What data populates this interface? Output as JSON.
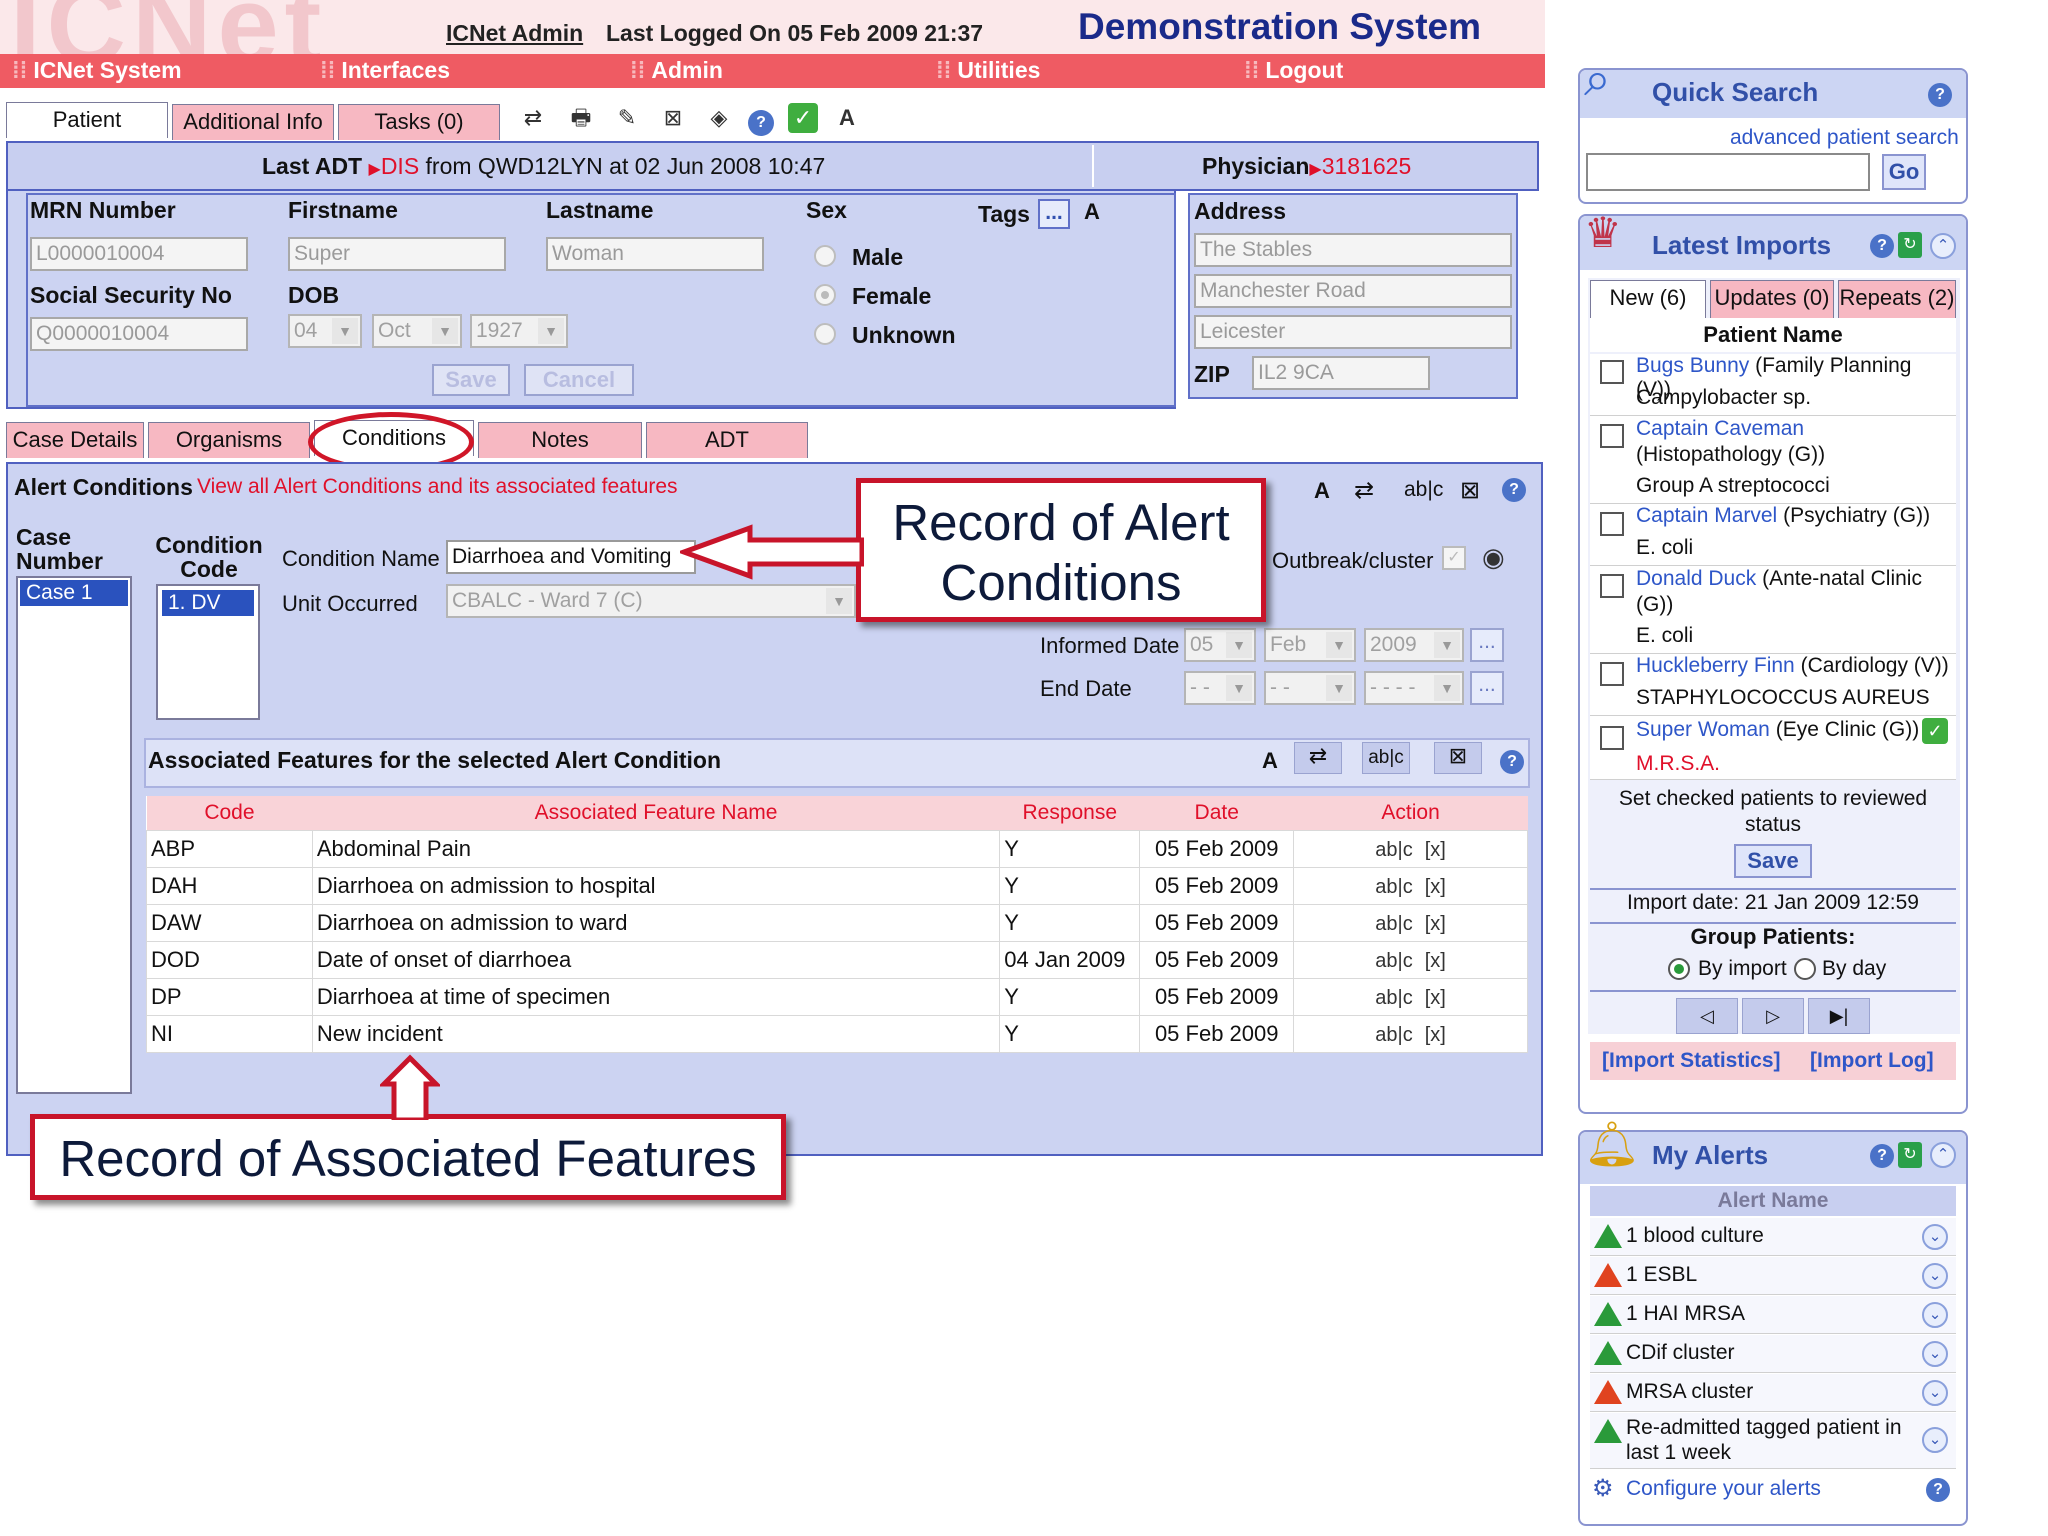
{
  "header": {
    "bg_logo": "ICNet",
    "admin_user": "ICNet Admin",
    "last_logged": "Last Logged On  05 Feb 2009 21:37",
    "system_title": "Demonstration System"
  },
  "menu": [
    "ICNet System",
    "Interfaces",
    "Admin",
    "Utilities",
    "Logout"
  ],
  "patient_tabs": [
    "Patient",
    "Additional Info",
    "Tasks (0)"
  ],
  "adt": {
    "label": "Last ADT",
    "code": "DIS",
    "text": "from QWD12LYN at 02 Jun 2008 10:47",
    "physician_label": "Physician",
    "physician_value": "3181625"
  },
  "patient": {
    "mrn_label": "MRN Number",
    "mrn_value": "L0000010004",
    "firstname_label": "Firstname",
    "firstname_value": "Super",
    "lastname_label": "Lastname",
    "lastname_value": "Woman",
    "sex_label": "Sex",
    "sex_options": [
      "Male",
      "Female",
      "Unknown"
    ],
    "sex_selected": "Female",
    "tags_label": "Tags",
    "tags_button": "...",
    "ssn_label": "Social Security No",
    "ssn_value": "Q0000010004",
    "dob_label": "DOB",
    "dob_day": "04",
    "dob_month": "Oct",
    "dob_year": "1927",
    "save": "Save",
    "cancel": "Cancel"
  },
  "address": {
    "label": "Address",
    "line1": "The Stables",
    "line2": "Manchester Road",
    "line3": "Leicester",
    "zip_label": "ZIP",
    "zip_value": "IL2 9CA"
  },
  "case_tabs": [
    "Case Details",
    "Organisms",
    "Conditions",
    "Notes",
    "ADT"
  ],
  "alert_conditions": {
    "title": "Alert Conditions",
    "link": "View all Alert Conditions and its associated features",
    "case_number_label": "Case Number",
    "case_item": "Case 1",
    "condition_code_label": "Condition Code",
    "condition_code_item": "1. DV",
    "condition_name_label": "Condition Name",
    "condition_name_value": "Diarrhoea and Vomiting",
    "unit_label": "Unit Occurred",
    "unit_value": "CBALC - Ward 7 (C)",
    "outbreak_label": "Outbreak/cluster",
    "informed_label": "Informed Date",
    "informed_day": "05",
    "informed_month": "Feb",
    "informed_year": "2009",
    "end_label": "End Date",
    "end_day": "- -",
    "end_month": "- -",
    "end_year": "- - - -",
    "ellipsis": "..."
  },
  "features": {
    "title": "Associated Features for the selected Alert Condition",
    "columns": [
      "Code",
      "Associated Feature Name",
      "Response",
      "Date",
      "Action"
    ],
    "rows": [
      [
        "ABP",
        "Abdominal Pain",
        "Y",
        "05 Feb 2009"
      ],
      [
        "DAH",
        "Diarrhoea on admission to hospital",
        "Y",
        "05 Feb 2009"
      ],
      [
        "DAW",
        "Diarrhoea on admission to ward",
        "Y",
        "05 Feb 2009"
      ],
      [
        "DOD",
        "Date of onset of diarrhoea",
        "04 Jan 2009",
        "05 Feb 2009"
      ],
      [
        "DP",
        "Diarrhoea at time of specimen",
        "Y",
        "05 Feb 2009"
      ],
      [
        "NI",
        "New incident",
        "Y",
        "05 Feb 2009"
      ]
    ],
    "action_edit": "ab|c",
    "action_delete": "[x]"
  },
  "callouts": {
    "alert_conditions": "Record of Alert Conditions",
    "associated_features": "Record of Associated Features"
  },
  "quick_search": {
    "title": "Quick Search",
    "advanced_link": "advanced patient search",
    "input_value": "",
    "go": "Go"
  },
  "latest_imports": {
    "title": "Latest Imports",
    "tabs": [
      "New (6)",
      "Updates (0)",
      "Repeats (2)"
    ],
    "column": "Patient Name",
    "patients": [
      {
        "name": "Bugs Bunny",
        "clinic": "(Family Planning (V))",
        "organism": "Campylobacter sp.",
        "organism_red": false
      },
      {
        "name": "Captain Caveman",
        "clinic": "(Histopathology (G))",
        "organism": "Group A streptococci",
        "organism_red": false
      },
      {
        "name": "Captain Marvel",
        "clinic": "(Psychiatry (G))",
        "organism": "E. coli",
        "organism_red": false
      },
      {
        "name": "Donald Duck",
        "clinic": "(Ante-natal Clinic (G))",
        "organism": "E. coli",
        "organism_red": false
      },
      {
        "name": "Huckleberry Finn",
        "clinic": "(Cardiology (V))",
        "organism": "STAPHYLOCOCCUS AUREUS",
        "organism_red": false
      },
      {
        "name": "Super Woman",
        "clinic": "(Eye Clinic (G))",
        "organism": "M.R.S.A.",
        "organism_red": true
      }
    ],
    "set_checked": "Set checked patients to reviewed status",
    "save": "Save",
    "import_date": "Import date: 21 Jan 2009 12:59",
    "group_label": "Group Patients:",
    "group_options": [
      "By import",
      "By day"
    ],
    "group_selected": "By import",
    "stats_link": "[Import Statistics]",
    "log_link": "[Import Log]"
  },
  "my_alerts": {
    "title": "My Alerts",
    "column": "Alert Name",
    "alerts": [
      {
        "name": "1 blood culture",
        "color": "#2a9a3a"
      },
      {
        "name": "1 ESBL",
        "color": "#e0431f"
      },
      {
        "name": "1 HAI MRSA",
        "color": "#2a9a3a"
      },
      {
        "name": "CDif cluster",
        "color": "#2a9a3a"
      },
      {
        "name": "MRSA cluster",
        "color": "#e0431f"
      },
      {
        "name": "Re-admitted tagged patient in last 1 week",
        "color": "#2a9a3a"
      }
    ],
    "configure": "Configure your alerts"
  },
  "colors": {
    "menu_bar": "#ef5b63",
    "panel": "#ccd3f2",
    "accent_red": "#e0102a",
    "link_blue": "#2e56c8",
    "title_blue": "#1a2a8a"
  }
}
